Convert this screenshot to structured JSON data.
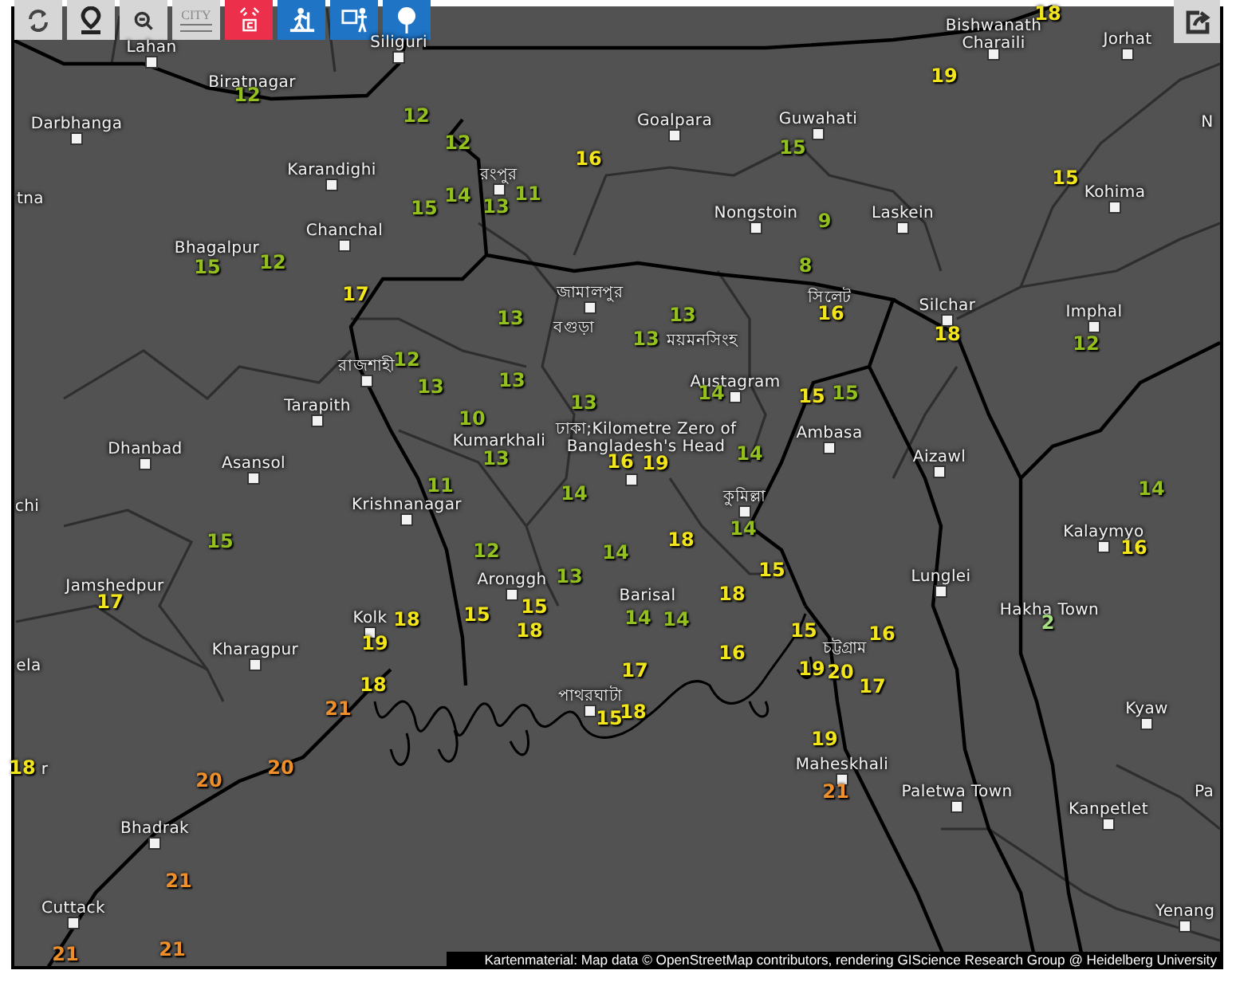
{
  "toolbar": [
    {
      "kind": "refresh"
    },
    {
      "kind": "locate"
    },
    {
      "kind": "zoom-out"
    },
    {
      "kind": "city",
      "label": "CITY"
    },
    {
      "kind": "tower"
    },
    {
      "kind": "hiker"
    },
    {
      "kind": "person"
    },
    {
      "kind": "pin"
    }
  ],
  "share_button": {
    "kind": "share"
  },
  "cities": [
    {
      "name": "Lahan",
      "marker": true
    },
    {
      "name": "Biratnagar",
      "marker": false
    },
    {
      "name": "Siliguri",
      "marker": true
    },
    {
      "name": "Darbhanga",
      "marker": true
    },
    {
      "name": "tna",
      "marker": false
    },
    {
      "name": "Karandighi",
      "marker": true
    },
    {
      "name": "Chanchal",
      "marker": true
    },
    {
      "name": "Bhagalpur",
      "marker": false
    },
    {
      "name": "Tarapith",
      "marker": true
    },
    {
      "name": "Dhanbad",
      "marker": true
    },
    {
      "name": "Asansol",
      "marker": true
    },
    {
      "name": "chi",
      "marker": false
    },
    {
      "name": "Krishnanagar",
      "marker": true
    },
    {
      "name": "Jamshedpur",
      "marker": false
    },
    {
      "name": "Kolk",
      "marker": true
    },
    {
      "name": "Kharagpur",
      "marker": true
    },
    {
      "name": "ela",
      "marker": false
    },
    {
      "name": "r",
      "marker": false
    },
    {
      "name": "Bhadrak",
      "marker": true
    },
    {
      "name": "Cuttack",
      "marker": true
    },
    {
      "name": "Goalpara",
      "marker": true
    },
    {
      "name": "Guwahati",
      "marker": true
    },
    {
      "name": "Nongstoin",
      "marker": true
    },
    {
      "name": "Laskein",
      "marker": true
    },
    {
      "name": "Bishwanath Charaili",
      "marker": true
    },
    {
      "name": "Jorhat",
      "marker": true
    },
    {
      "name": "N",
      "marker": false
    },
    {
      "name": "Kohima",
      "marker": true
    },
    {
      "name": "Silchar",
      "marker": true
    },
    {
      "name": "Imphal",
      "marker": true
    },
    {
      "name": "Austagram",
      "marker": true
    },
    {
      "name": "Ambasa",
      "marker": true
    },
    {
      "name": "Aizawl",
      "marker": true
    },
    {
      "name": "Kumarkhali",
      "marker": false
    },
    {
      "name": "Aronggh",
      "marker": true
    },
    {
      "name": "Barisal",
      "marker": false
    },
    {
      "name": "Kalaymyo",
      "marker": true
    },
    {
      "name": "Lunglei",
      "marker": true
    },
    {
      "name": "Hakha Town",
      "marker": false
    },
    {
      "name": "Kyaw",
      "marker": true
    },
    {
      "name": "Maheskhali",
      "marker": true
    },
    {
      "name": "Paletwa Town",
      "marker": true
    },
    {
      "name": "Pa",
      "marker": false
    },
    {
      "name": "Kanpetlet",
      "marker": true
    },
    {
      "name": "Yenang",
      "marker": true
    },
    {
      "name": "রংপুর",
      "marker": true
    },
    {
      "name": "জামালপুর",
      "marker": true
    },
    {
      "name": "বগুড়া",
      "marker": false
    },
    {
      "name": "রাজশাহী",
      "marker": true
    },
    {
      "name": "ময়মনসিংহ",
      "marker": false
    },
    {
      "name": "ঢাকা;Kilometre Zero of Bangladesh's Head",
      "marker": true
    },
    {
      "name": "কুমিল্লা",
      "marker": true
    },
    {
      "name": "সিলেট",
      "marker": false
    },
    {
      "name": "পাথরঘাটা",
      "marker": true
    },
    {
      "name": "চট্টগ্রাম",
      "marker": false
    }
  ],
  "temperatures": [
    {
      "value": "18",
      "color": "#f2e51b"
    },
    {
      "value": "19",
      "color": "#f2e51b"
    },
    {
      "value": "12",
      "color": "#93c01f"
    },
    {
      "value": "12",
      "color": "#93c01f"
    },
    {
      "value": "12",
      "color": "#93c01f"
    },
    {
      "value": "15",
      "color": "#93c01f"
    },
    {
      "value": "16",
      "color": "#f2e51b"
    },
    {
      "value": "15",
      "color": "#f2e51b"
    },
    {
      "value": "15",
      "color": "#93c01f"
    },
    {
      "value": "14",
      "color": "#93c01f"
    },
    {
      "value": "13",
      "color": "#93c01f"
    },
    {
      "value": "11",
      "color": "#93c01f"
    },
    {
      "value": "9",
      "color": "#93c01f"
    },
    {
      "value": "15",
      "color": "#93c01f"
    },
    {
      "value": "12",
      "color": "#93c01f"
    },
    {
      "value": "8",
      "color": "#93c01f"
    },
    {
      "value": "17",
      "color": "#f2e51b"
    },
    {
      "value": "13",
      "color": "#93c01f"
    },
    {
      "value": "13",
      "color": "#93c01f"
    },
    {
      "value": "16",
      "color": "#f2e51b"
    },
    {
      "value": "13",
      "color": "#93c01f"
    },
    {
      "value": "18",
      "color": "#f2e51b"
    },
    {
      "value": "12",
      "color": "#93c01f"
    },
    {
      "value": "12",
      "color": "#93c01f"
    },
    {
      "value": "13",
      "color": "#93c01f"
    },
    {
      "value": "13",
      "color": "#93c01f"
    },
    {
      "value": "13",
      "color": "#93c01f"
    },
    {
      "value": "14",
      "color": "#93c01f"
    },
    {
      "value": "15",
      "color": "#f2e51b"
    },
    {
      "value": "15",
      "color": "#93c01f"
    },
    {
      "value": "10",
      "color": "#93c01f"
    },
    {
      "value": "13",
      "color": "#93c01f"
    },
    {
      "value": "16",
      "color": "#f2e51b"
    },
    {
      "value": "19",
      "color": "#f2e51b"
    },
    {
      "value": "14",
      "color": "#93c01f"
    },
    {
      "value": "11",
      "color": "#93c01f"
    },
    {
      "value": "14",
      "color": "#93c01f"
    },
    {
      "value": "14",
      "color": "#93c01f"
    },
    {
      "value": "14",
      "color": "#93c01f"
    },
    {
      "value": "15",
      "color": "#93c01f"
    },
    {
      "value": "12",
      "color": "#93c01f"
    },
    {
      "value": "14",
      "color": "#93c01f"
    },
    {
      "value": "18",
      "color": "#f2e51b"
    },
    {
      "value": "16",
      "color": "#f2e51b"
    },
    {
      "value": "13",
      "color": "#93c01f"
    },
    {
      "value": "15",
      "color": "#f2e51b"
    },
    {
      "value": "17",
      "color": "#f2e51b"
    },
    {
      "value": "18",
      "color": "#f2e51b"
    },
    {
      "value": "15",
      "color": "#f2e51b"
    },
    {
      "value": "15",
      "color": "#f2e51b"
    },
    {
      "value": "14",
      "color": "#93c01f"
    },
    {
      "value": "14",
      "color": "#93c01f"
    },
    {
      "value": "18",
      "color": "#f2e51b"
    },
    {
      "value": "2",
      "color": "#a6df7f"
    },
    {
      "value": "19",
      "color": "#f2e51b"
    },
    {
      "value": "18",
      "color": "#f2e51b"
    },
    {
      "value": "15",
      "color": "#f2e51b"
    },
    {
      "value": "16",
      "color": "#f2e51b"
    },
    {
      "value": "17",
      "color": "#f2e51b"
    },
    {
      "value": "16",
      "color": "#f2e51b"
    },
    {
      "value": "19",
      "color": "#f2e51b"
    },
    {
      "value": "20",
      "color": "#f2e51b"
    },
    {
      "value": "18",
      "color": "#f2e51b"
    },
    {
      "value": "17",
      "color": "#f2e51b"
    },
    {
      "value": "21",
      "color": "#ee8f2a"
    },
    {
      "value": "15",
      "color": "#f2e51b"
    },
    {
      "value": "18",
      "color": "#f2e51b"
    },
    {
      "value": "19",
      "color": "#f2e51b"
    },
    {
      "value": "18",
      "color": "#f2e51b"
    },
    {
      "value": "20",
      "color": "#ee8f2a"
    },
    {
      "value": "20",
      "color": "#ee8f2a"
    },
    {
      "value": "21",
      "color": "#ee8f2a"
    },
    {
      "value": "21",
      "color": "#ee8f2a"
    },
    {
      "value": "21",
      "color": "#ee8f2a"
    },
    {
      "value": "21",
      "color": "#ee8f2a"
    }
  ],
  "attribution": "Kartenmaterial: Map data © OpenStreetMap contributors, rendering GIScience Research Group @ Heidelberg University"
}
